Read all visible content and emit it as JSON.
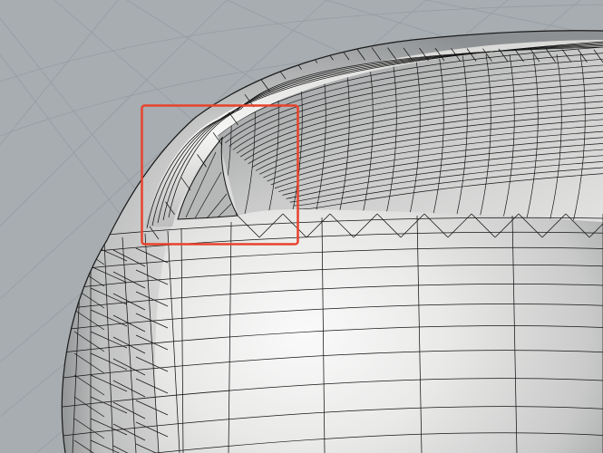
{
  "viewport": {
    "view": "perspective",
    "display_mode": "shaded-with-mesh-wireframe",
    "background_color": "#a7adb1",
    "construction_grid_color": "#969ca1",
    "mesh_edge_color": "#151515",
    "surface_highlight_color": "#fafafa",
    "surface_shadow_color": "#6f7275"
  },
  "annotation": {
    "shape": "rectangle",
    "stroke_color": "#e8432c",
    "meaning": "highlighted-mesh-defect"
  }
}
